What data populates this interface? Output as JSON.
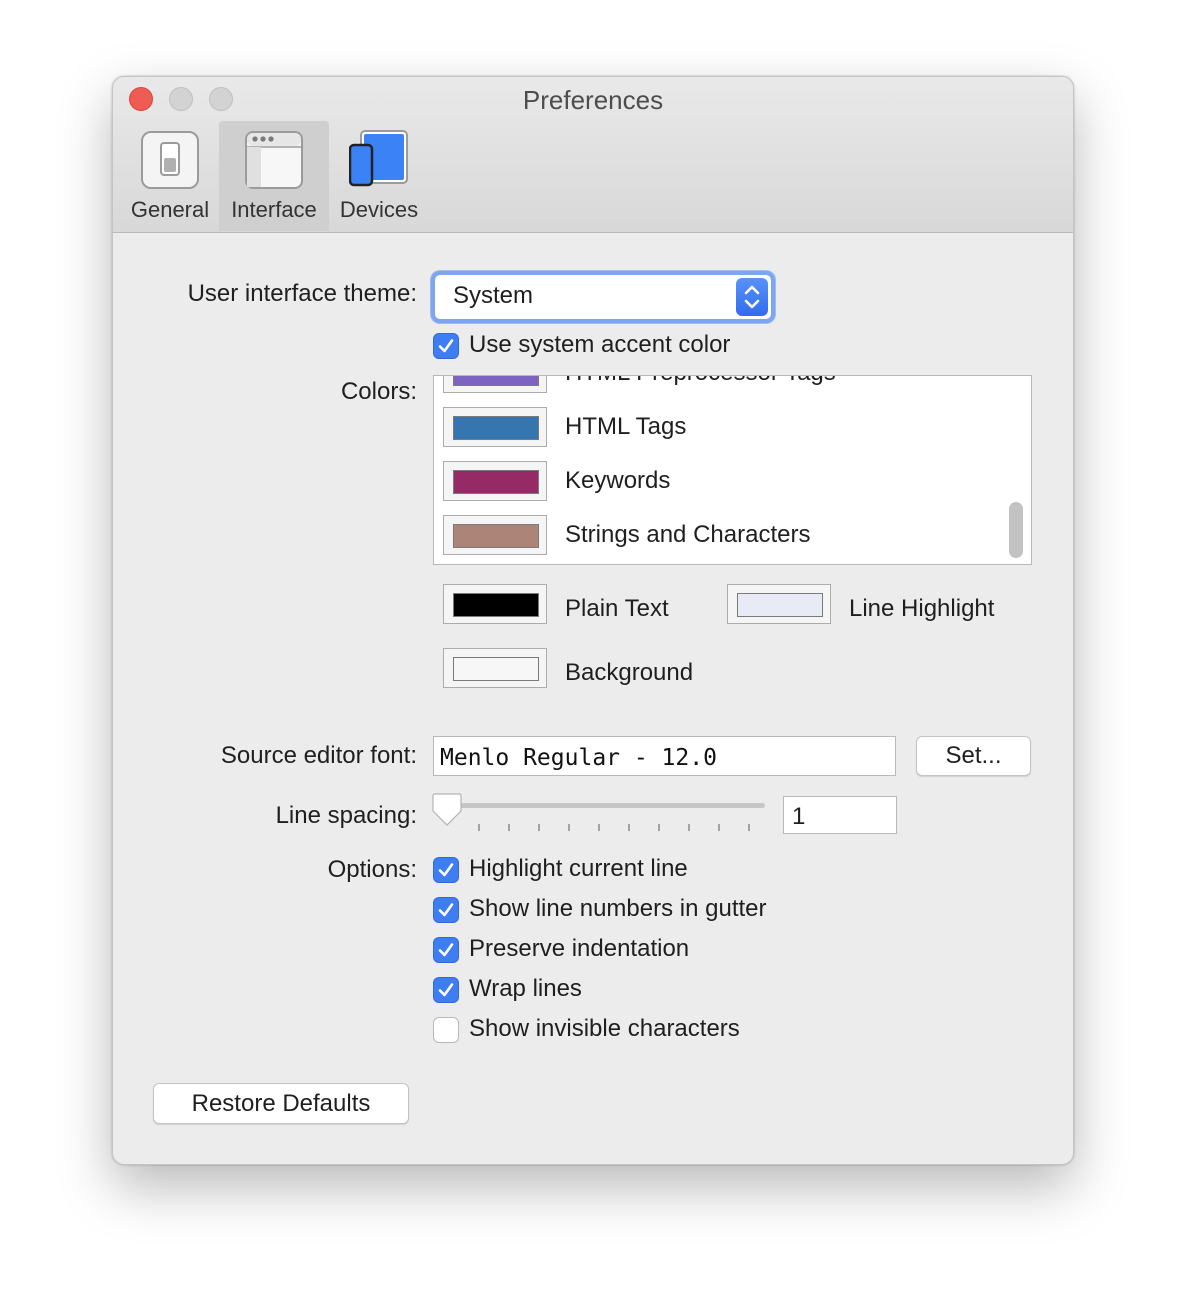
{
  "window": {
    "title": "Preferences"
  },
  "tabs": [
    {
      "label": "General",
      "icon": "toggle-switch-icon"
    },
    {
      "label": "Interface",
      "icon": "window-icon"
    },
    {
      "label": "Devices",
      "icon": "devices-icon"
    }
  ],
  "active_tab": "Interface",
  "theme": {
    "label": "User interface theme:",
    "value": "System"
  },
  "accent": {
    "label": "Use system accent color",
    "checked": true
  },
  "colors": {
    "label": "Colors:",
    "list": [
      {
        "name": "HTML Preprocessor Tags",
        "color": "#7f63c0"
      },
      {
        "name": "HTML Tags",
        "color": "#3575b0"
      },
      {
        "name": "Keywords",
        "color": "#962a67"
      },
      {
        "name": "Strings and Characters",
        "color": "#ac8478"
      }
    ],
    "plain_text": {
      "label": "Plain Text",
      "color": "#000000"
    },
    "line_highlight": {
      "label": "Line Highlight",
      "color": "#e8ebf6"
    },
    "background": {
      "label": "Background",
      "color": "#f7f7f7"
    }
  },
  "font": {
    "label": "Source editor font:",
    "value": "Menlo Regular - 12.0",
    "set_button": "Set..."
  },
  "line_spacing": {
    "label": "Line spacing:",
    "value": "1"
  },
  "options": {
    "label": "Options:",
    "items": [
      {
        "label": "Highlight current line",
        "checked": true
      },
      {
        "label": "Show line numbers in gutter",
        "checked": true
      },
      {
        "label": "Preserve indentation",
        "checked": true
      },
      {
        "label": "Wrap lines",
        "checked": true
      },
      {
        "label": "Show invisible characters",
        "checked": false
      }
    ]
  },
  "restore_button": "Restore Defaults"
}
